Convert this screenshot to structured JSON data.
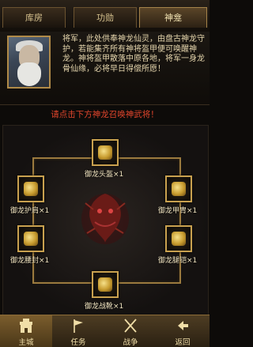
{
  "tabs": [
    {
      "label": "库房"
    },
    {
      "label": "功勋"
    },
    {
      "label": "神龛"
    }
  ],
  "info": {
    "text": "将军，此处供奉神龙仙灵，由盘古神龙守护，若能集齐所有神将盔甲便可唤醒神龙。神将盔甲散落中原各地，将军一身龙骨仙缘，必将早日得偿所愿！"
  },
  "prompt": "请点击下方神龙召唤神武将！",
  "slots": [
    {
      "label": "御龙头盔×1",
      "icon": "helmet-icon"
    },
    {
      "label": "御龙护肩×1",
      "icon": "shoulder-guard-icon"
    },
    {
      "label": "御龙甲胄×1",
      "icon": "armor-icon"
    },
    {
      "label": "御龙腰封×1",
      "icon": "belt-icon"
    },
    {
      "label": "御龙腿铠×1",
      "icon": "leg-armor-icon"
    },
    {
      "label": "御龙战靴×1",
      "icon": "boots-icon"
    }
  ],
  "nav": [
    {
      "label": "主城",
      "icon": "castle-icon"
    },
    {
      "label": "任务",
      "icon": "flag-icon"
    },
    {
      "label": "战争",
      "icon": "crossed-swords-icon"
    },
    {
      "label": "返回",
      "icon": "back-icon"
    }
  ],
  "colors": {
    "accent_gold": "#c9a14f",
    "prompt_red": "#e0452c",
    "background": "#0d0b09"
  }
}
